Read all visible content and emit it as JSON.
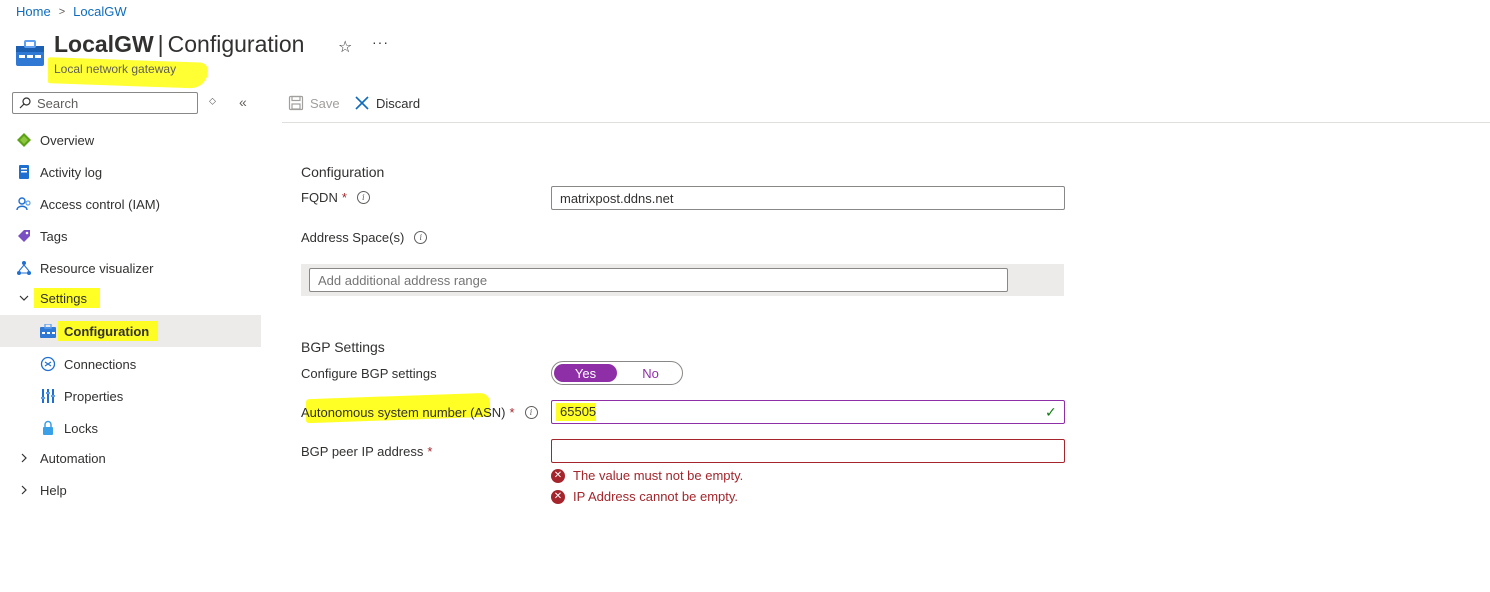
{
  "breadcrumb": {
    "home": "Home",
    "separator": ">",
    "current": "LocalGW"
  },
  "header": {
    "resource_name": "LocalGW",
    "divider": "|",
    "page": "Configuration",
    "subtitle": "Local network gateway",
    "star_icon": "☆",
    "more_icon": "···"
  },
  "search": {
    "placeholder": "Search"
  },
  "sidebar": {
    "items": [
      {
        "label": "Overview",
        "icon": "overview-icon"
      },
      {
        "label": "Activity log",
        "icon": "activity-log-icon"
      },
      {
        "label": "Access control (IAM)",
        "icon": "iam-icon"
      },
      {
        "label": "Tags",
        "icon": "tag-icon"
      },
      {
        "label": "Resource visualizer",
        "icon": "resource-visualizer-icon"
      },
      {
        "label": "Settings",
        "icon": "chevron-down-icon",
        "expanded": true
      },
      {
        "label": "Configuration",
        "icon": "configuration-icon",
        "active": true
      },
      {
        "label": "Connections",
        "icon": "connections-icon"
      },
      {
        "label": "Properties",
        "icon": "properties-icon"
      },
      {
        "label": "Locks",
        "icon": "lock-icon"
      },
      {
        "label": "Automation",
        "icon": "chevron-right-icon"
      },
      {
        "label": "Help",
        "icon": "chevron-right-icon"
      }
    ]
  },
  "toolbar": {
    "save_label": "Save",
    "discard_label": "Discard"
  },
  "form": {
    "section_configuration": "Configuration",
    "fqdn_label": "FQDN",
    "fqdn_value": "matrixpost.ddns.net",
    "address_space_label": "Address Space(s)",
    "address_range_placeholder": "Add additional address range",
    "section_bgp": "BGP Settings",
    "configure_bgp_label": "Configure BGP settings",
    "toggle_yes": "Yes",
    "toggle_no": "No",
    "toggle_selected": "Yes",
    "asn_label": "Autonomous system number (ASN)",
    "asn_value": "65505",
    "bgp_peer_label": "BGP peer IP address",
    "bgp_peer_value": "",
    "required_mark": "*",
    "errors": [
      "The value must not be empty.",
      "IP Address cannot be empty."
    ]
  },
  "colors": {
    "accent": "#0f6cbd",
    "toggle": "#8f2fa8",
    "error": "#a4262c",
    "valid": "#107c10",
    "highlight": "#ffff33"
  }
}
